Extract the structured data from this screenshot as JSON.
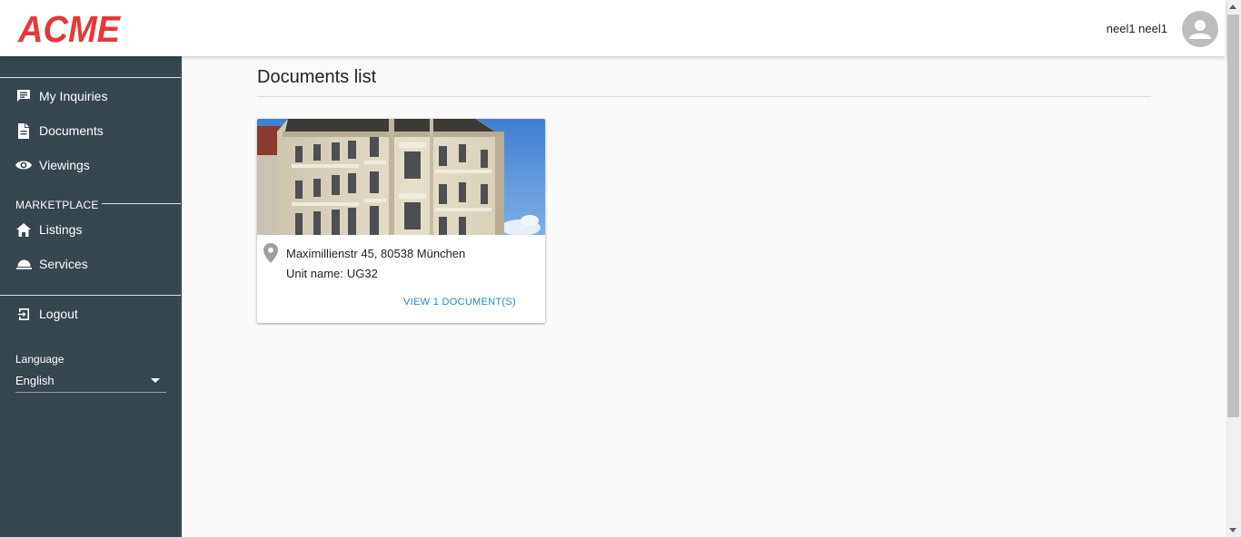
{
  "header": {
    "logo_text": "ACME",
    "user_name": "neel1 neel1",
    "avatar_icon": "account-circle-icon"
  },
  "sidebar": {
    "items": [
      {
        "label": "My Inquiries",
        "icon": "chat-icon"
      },
      {
        "label": "Documents",
        "icon": "document-icon"
      },
      {
        "label": "Viewings",
        "icon": "eye-icon"
      }
    ],
    "marketplace_title": "MARKETPLACE",
    "marketplace_items": [
      {
        "label": "Listings",
        "icon": "home-icon"
      },
      {
        "label": "Services",
        "icon": "service-bell-icon"
      }
    ],
    "logout": {
      "label": "Logout",
      "icon": "logout-icon"
    },
    "language": {
      "label": "Language",
      "value": "English"
    }
  },
  "main": {
    "title": "Documents list",
    "cards": [
      {
        "address": "Maximillienstr 45, 80538 München",
        "unit_prefix": "Unit name:",
        "unit_name": "UG32",
        "action": "VIEW 1 DOCUMENT(S)"
      }
    ]
  },
  "colors": {
    "sidebar_bg": "#37474f",
    "logo_red": "#e53935",
    "link_blue": "#1e88e5",
    "page_bg": "#fafafa"
  }
}
